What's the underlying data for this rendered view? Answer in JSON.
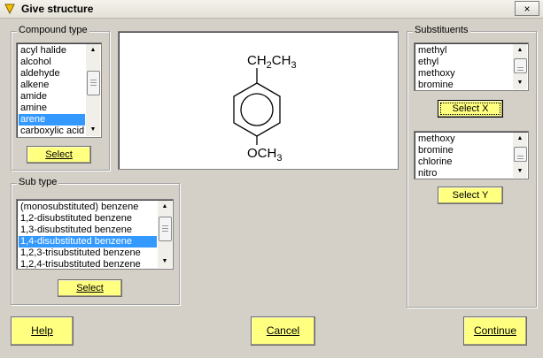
{
  "window": {
    "title": "Give structure",
    "close_label": "×"
  },
  "compound_type": {
    "label": "Compound type",
    "items": [
      "acyl halide",
      "alcohol",
      "aldehyde",
      "alkene",
      "amide",
      "amine",
      "arene",
      "carboxylic acid"
    ],
    "selected": "arene",
    "select_label": "Select",
    "select_mnemonic": "S"
  },
  "sub_type": {
    "label": "Sub type",
    "items": [
      "(monosubstituted) benzene",
      "1,2-disubstituted benzene",
      "1,3-disubstituted benzene",
      "1,4-disubstituted benzene",
      "1,2,3-trisubstituted benzene",
      "1,2,4-trisubstituted benzene"
    ],
    "selected": "1,4-disubstituted benzene",
    "select_label": "Select"
  },
  "structure": {
    "top_group": "CH2CH3",
    "bottom_group": "OCH3"
  },
  "substituents": {
    "label": "Substituents",
    "x_items": [
      "methyl",
      "ethyl",
      "methoxy",
      "bromine"
    ],
    "select_x_label": "Select X",
    "y_items": [
      "methoxy",
      "bromine",
      "chlorine",
      "nitro"
    ],
    "select_y_label": "Select Y"
  },
  "footer": {
    "help_label": "Help",
    "cancel_label": "Cancel",
    "continue_label": "Continue"
  },
  "colors": {
    "button_yellow": "#ffff80",
    "selection_blue": "#3399ff",
    "dialog_gray": "#d4d0c8"
  }
}
